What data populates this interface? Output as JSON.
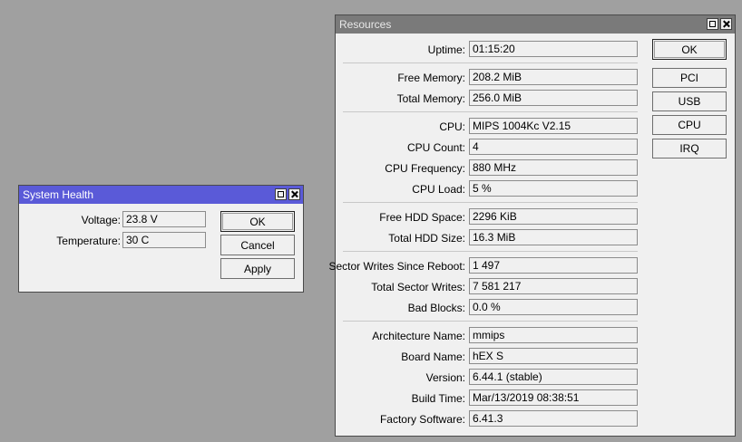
{
  "system_health": {
    "title": "System Health",
    "fields": [
      {
        "label": "Voltage:",
        "value": "23.8 V"
      },
      {
        "label": "Temperature:",
        "value": "30 C"
      }
    ],
    "buttons": {
      "ok": "OK",
      "cancel": "Cancel",
      "apply": "Apply"
    }
  },
  "resources": {
    "title": "Resources",
    "fields": [
      {
        "label": "Uptime:",
        "value": "01:15:20"
      },
      {
        "label": "Free Memory:",
        "value": "208.2 MiB"
      },
      {
        "label": "Total Memory:",
        "value": "256.0 MiB"
      },
      {
        "label": "CPU:",
        "value": "MIPS 1004Kc V2.15"
      },
      {
        "label": "CPU Count:",
        "value": "4"
      },
      {
        "label": "CPU Frequency:",
        "value": "880 MHz"
      },
      {
        "label": "CPU Load:",
        "value": "5 %"
      },
      {
        "label": "Free HDD Space:",
        "value": "2296 KiB"
      },
      {
        "label": "Total HDD Size:",
        "value": "16.3 MiB"
      },
      {
        "label": "Sector Writes Since Reboot:",
        "value": "1 497"
      },
      {
        "label": "Total Sector Writes:",
        "value": "7 581 217"
      },
      {
        "label": "Bad Blocks:",
        "value": "0.0 %"
      },
      {
        "label": "Architecture Name:",
        "value": "mmips"
      },
      {
        "label": "Board Name:",
        "value": "hEX S"
      },
      {
        "label": "Version:",
        "value": "6.44.1 (stable)"
      },
      {
        "label": "Build Time:",
        "value": "Mar/13/2019 08:38:51"
      },
      {
        "label": "Factory Software:",
        "value": "6.41.3"
      }
    ],
    "buttons": {
      "ok": "OK",
      "pci": "PCI",
      "usb": "USB",
      "cpu": "CPU",
      "irq": "IRQ"
    }
  },
  "colors": {
    "desktop": "#a0a0a0",
    "active_title": "#5a5ad8",
    "inactive_title": "#7a7a7a"
  }
}
